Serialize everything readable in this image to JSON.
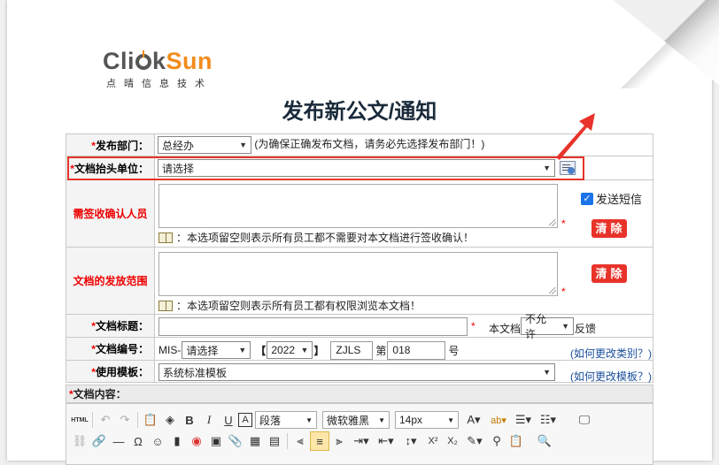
{
  "logo": {
    "word_a": "Cli",
    "word_b": "k",
    "word_c": "Sun",
    "subtitle": "点晴信息技术"
  },
  "title": "发布新公文/通知",
  "fields": {
    "dept": {
      "label": "发布部门",
      "value": "总经办",
      "hint": "(为确保正确发布文档，请务必先选择发布部门！)"
    },
    "header_unit": {
      "label": "文档抬头单位",
      "value": "请选择"
    },
    "confirm": {
      "label": "需签收确认人员",
      "note": "：本选项留空则表示所有员工都不需要对本文档进行签收确认！",
      "sms_label": "发送短信",
      "clear_label": "清除"
    },
    "scope": {
      "label": "文档的发放范围",
      "note": "：本选项留空则表示所有员工都有权限浏览本文档！",
      "clear_label": "清除"
    },
    "doc_title": {
      "label": "文档标题",
      "value": "",
      "feedback_pre": "本文档",
      "feedback_value": "不允许",
      "feedback_post": "反馈"
    },
    "doc_number": {
      "label": "文档编号",
      "prefix": "MIS-",
      "category": "请选择",
      "bracket_open": "【",
      "year": "2022",
      "bracket_close": "】",
      "code": "ZJLS",
      "di": "第",
      "num": "018",
      "hao": "号",
      "link": "(如何更改类别？)"
    },
    "template": {
      "label": "使用模板",
      "value": "系统标准模板",
      "link": "(如何更改模板？)"
    },
    "content": {
      "label": "文档内容："
    }
  },
  "editor": {
    "paragraph": "段落",
    "font": "微软雅黑",
    "size": "14px"
  },
  "colors": {
    "accent_red": "#e8332a",
    "label_bg": "#f4f4f4",
    "link": "#1a4f9c",
    "logo_orange": "#f28c1e"
  }
}
